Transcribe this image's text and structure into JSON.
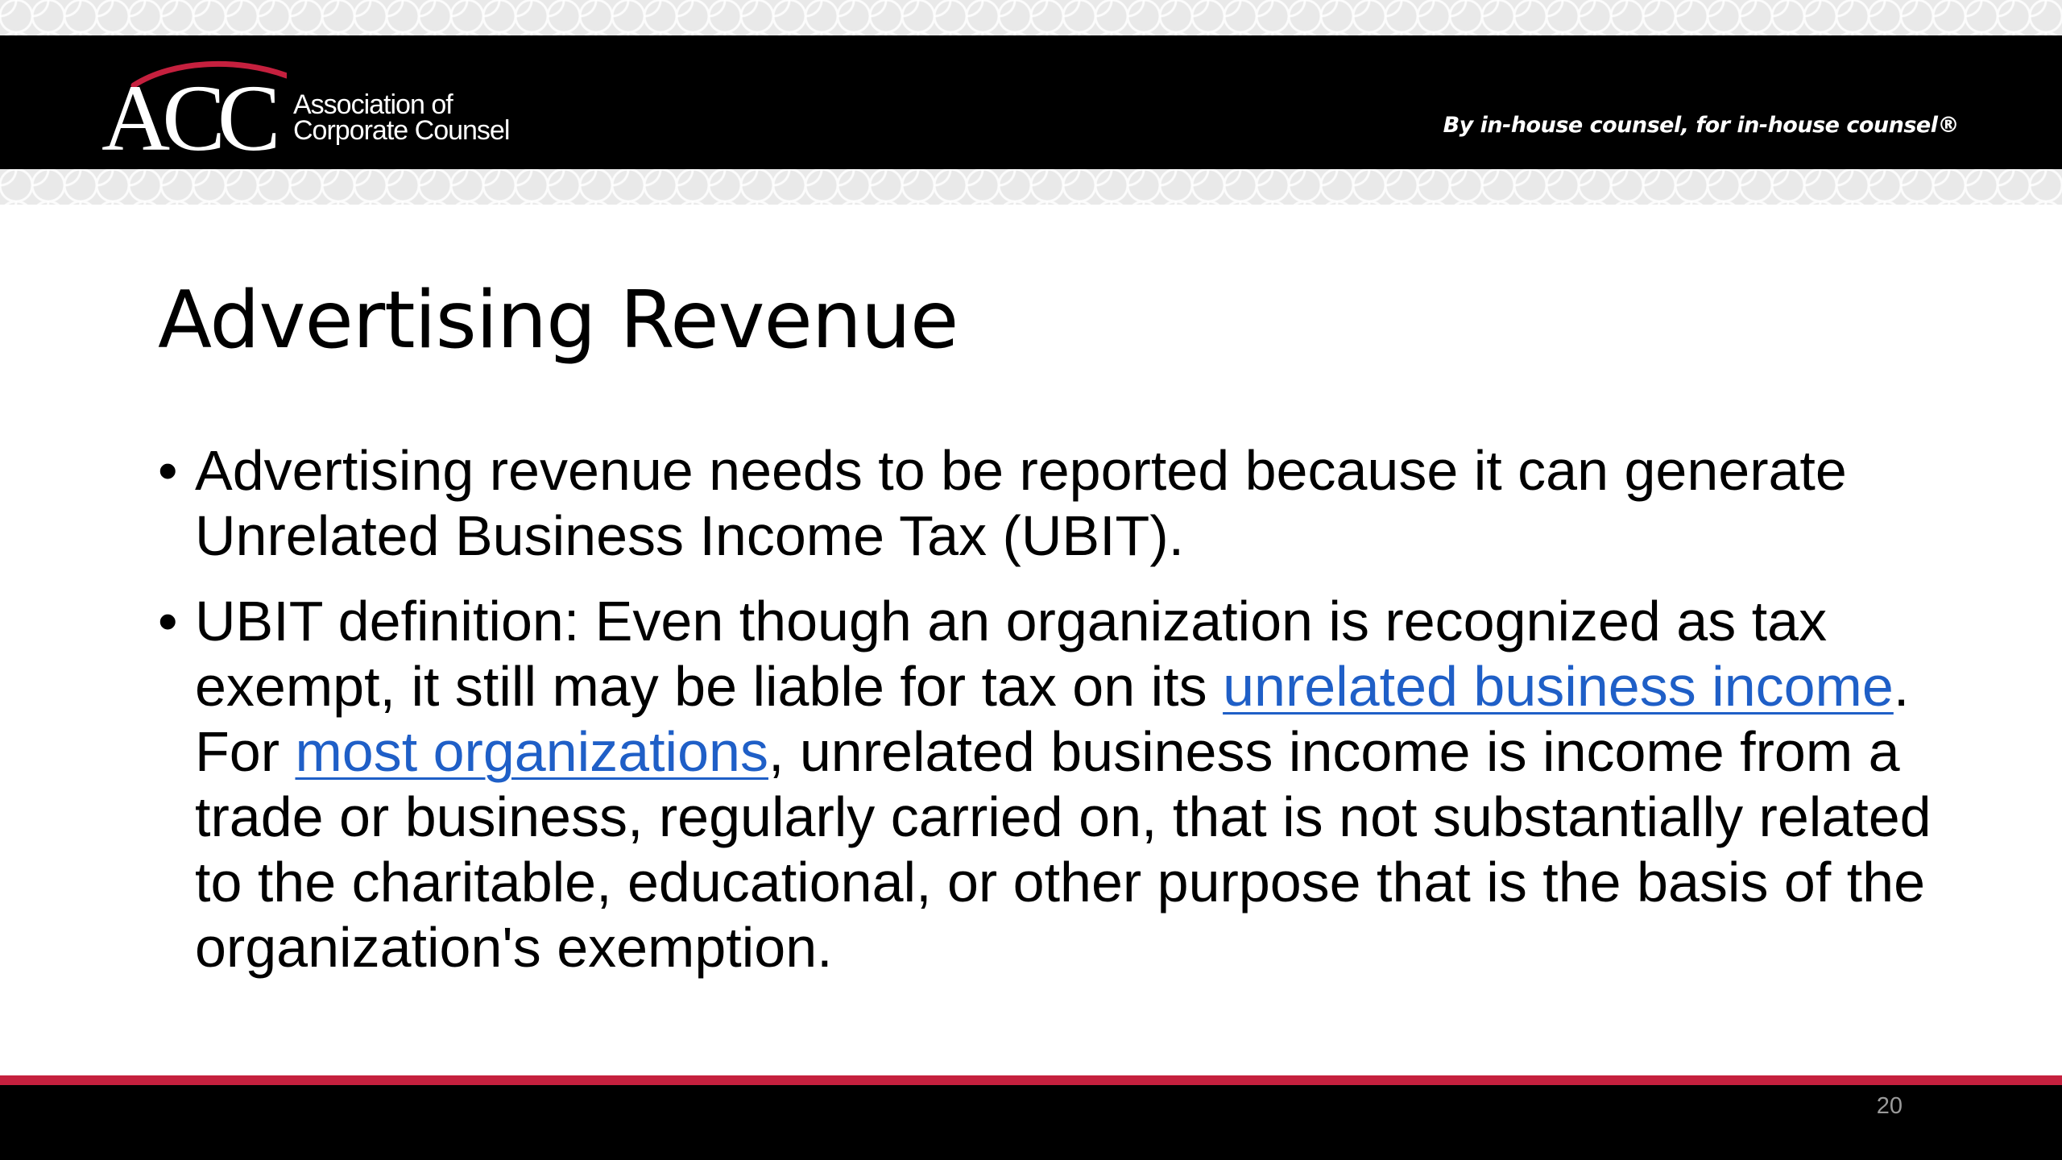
{
  "header": {
    "logo_mark": "ACC",
    "logo_line1": "Association of",
    "logo_line2": "Corporate Counsel",
    "tagline": "By in-house counsel, for in-house counsel®"
  },
  "slide": {
    "title": "Advertising Revenue",
    "bullets": [
      {
        "text": "Advertising revenue needs to be reported because it can generate Unrelated Business Income Tax (UBIT)."
      },
      {
        "part1": "UBIT definition: Even though an organization is recognized as tax exempt, it still may be liable for tax on its ",
        "link1": "unrelated business income",
        "part2": ". For ",
        "link2": "most organizations",
        "part3": ", unrelated business income is income from a trade or business, regularly carried on, that is not substantially related to the charitable, educational, or other purpose that is the basis of the organization's exemption."
      }
    ],
    "bullet_symbol": "•"
  },
  "footer": {
    "page_number": "20"
  },
  "colors": {
    "header_bg": "#000000",
    "accent_red": "#c5203e",
    "link_blue": "#1f5fc7",
    "page_number": "#9a9a9a"
  }
}
